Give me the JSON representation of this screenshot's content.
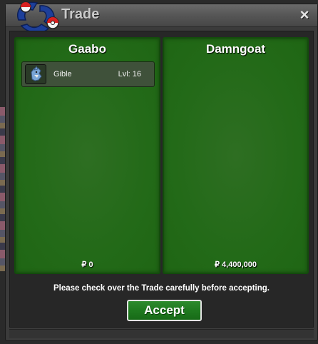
{
  "window": {
    "title": "Trade",
    "close_label": "×"
  },
  "left_panel": {
    "player_name": "Gaabo",
    "money": "₽ 0",
    "items": [
      {
        "name": "Gible",
        "level": "Lvl: 16",
        "icon": "gible-icon"
      }
    ]
  },
  "right_panel": {
    "player_name": "Damngoat",
    "money": "₽ 4,400,000"
  },
  "notice": "Please check over the Trade carefully before accepting.",
  "accept_label": "Accept",
  "colors": {
    "panel_green": "#236a18",
    "button_green": "#1f7a1f",
    "title_text": "#c9c9c9"
  }
}
